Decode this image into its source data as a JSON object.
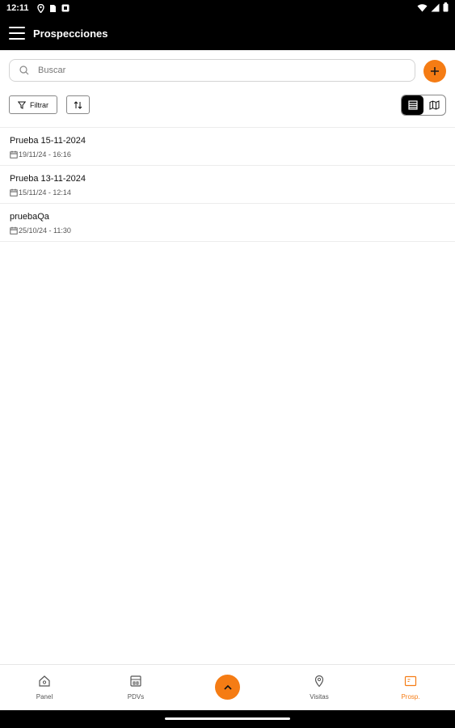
{
  "status_bar": {
    "time": "12:11",
    "icons": [
      "location-icon",
      "sim-icon",
      "notification-icon",
      "wifi-icon",
      "signal-icon",
      "battery-icon"
    ]
  },
  "app_bar": {
    "title": "Prospecciones",
    "menu_icon": "hamburger-menu-icon"
  },
  "search": {
    "placeholder": "Buscar",
    "value": ""
  },
  "toolbar": {
    "filter_label": "Filtrar",
    "sort_icon": "sort-arrows-icon",
    "view_modes": [
      "list-view-icon",
      "map-view-icon"
    ],
    "active_view": "list"
  },
  "items": [
    {
      "name": "Prueba 15-11-2024",
      "date": "19/11/24 - 16:16"
    },
    {
      "name": "Prueba 13-11-2024",
      "date": "15/11/24 - 12:14"
    },
    {
      "name": "pruebaQa",
      "date": "25/10/24 - 11:30"
    }
  ],
  "bottom_nav": {
    "items": [
      {
        "label": "Panel",
        "icon": "home-icon",
        "active": false
      },
      {
        "label": "PDVs",
        "icon": "store-icon",
        "active": false
      },
      {
        "label": "Visitas",
        "icon": "map-pin-icon",
        "active": false
      },
      {
        "label": "Prosp.",
        "icon": "prospect-card-icon",
        "active": true
      }
    ],
    "center_icon": "chevron-up-icon"
  },
  "colors": {
    "accent": "#f57c14",
    "bar": "#000000"
  }
}
